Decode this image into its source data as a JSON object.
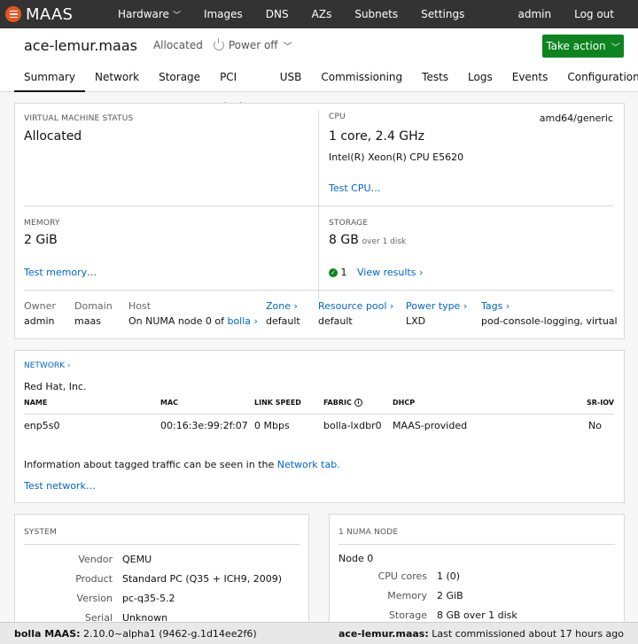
{
  "nav": {
    "brand": "MAAS",
    "items": [
      {
        "label": "Hardware",
        "has_menu": true
      },
      {
        "label": "Images"
      },
      {
        "label": "DNS"
      },
      {
        "label": "AZs"
      },
      {
        "label": "Subnets"
      },
      {
        "label": "Settings"
      }
    ],
    "user": "admin",
    "logout": "Log out"
  },
  "header": {
    "hostname": "ace-lemur.maas",
    "status": "Allocated",
    "power": "Power off",
    "take_action": "Take action"
  },
  "tabs": [
    "Summary",
    "Network",
    "Storage",
    "PCI devices",
    "USB",
    "Commissioning",
    "Tests",
    "Logs",
    "Events",
    "Configuration"
  ],
  "summary": {
    "vm_status_label": "VIRTUAL MACHINE STATUS",
    "vm_status": "Allocated",
    "cpu_label": "CPU",
    "cpu_arch": "amd64/generic",
    "cpu_main": "1 core, 2.4 GHz",
    "cpu_model": "Intel(R) Xeon(R) CPU E5620",
    "test_cpu": "Test CPU…",
    "memory_label": "MEMORY",
    "memory": "2 GiB",
    "test_memory": "Test memory…",
    "storage_label": "STORAGE",
    "storage": "8 GB",
    "storage_sub": "over 1 disk",
    "storage_passed": "1",
    "view_results": "View results ›",
    "owner_label": "Owner",
    "owner": "admin",
    "domain_label": "Domain",
    "domain": "maas",
    "host_label": "Host",
    "host_prefix": "On NUMA node 0 of",
    "host_link": "bolla ›",
    "zone_label": "Zone ›",
    "zone": "default",
    "pool_label": "Resource pool ›",
    "pool": "default",
    "power_type_label": "Power type ›",
    "power_type": "LXD",
    "tags_label": "Tags ›",
    "tags": "pod-console-logging, virtual"
  },
  "network": {
    "title": "NETWORK ›",
    "vendor": "Red Hat, Inc.",
    "columns": {
      "name": "NAME",
      "mac": "MAC",
      "speed": "LINK SPEED",
      "fabric": "FABRIC",
      "dhcp": "DHCP",
      "sriov": "SR-IOV"
    },
    "row": {
      "name": "enp5s0",
      "mac": "00:16:3e:99:2f:07",
      "speed": "0 Mbps",
      "fabric": "bolla-lxdbr0",
      "dhcp": "MAAS-provided",
      "sriov": "No"
    },
    "info_prefix": "Information about tagged traffic can be seen in the",
    "info_link": "Network tab.",
    "test_network": "Test network…"
  },
  "system": {
    "title": "SYSTEM",
    "vendor_key": "Vendor",
    "vendor": "QEMU",
    "product_key": "Product",
    "product": "Standard PC (Q35 + ICH9, 2009)",
    "version_key": "Version",
    "version": "pc-q35-5.2",
    "serial_key": "Serial",
    "serial": "Unknown"
  },
  "numa": {
    "title": "1 NUMA NODE",
    "node": "Node 0",
    "cores_key": "CPU cores",
    "cores": "1 (0)",
    "memory_key": "Memory",
    "memory": "2 GiB",
    "storage_key": "Storage",
    "storage": "8 GB over 1 disk"
  },
  "footer": {
    "left_bold": "bolla MAAS:",
    "left": "2.10.0~alpha1 (9462-g.1d14ee2f6)",
    "right_bold": "ace-lemur.maas:",
    "right": "Last commissioned about 17 hours ago"
  }
}
